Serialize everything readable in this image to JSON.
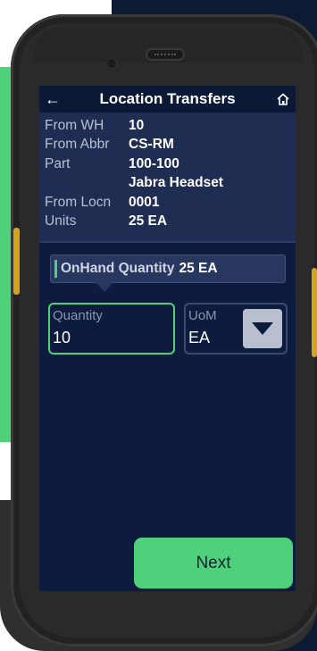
{
  "header": {
    "title": "Location Transfers",
    "back_icon": "←",
    "home_icon": "home-icon"
  },
  "details": [
    {
      "label": "From WH",
      "value": "10"
    },
    {
      "label": "From Abbr",
      "value": "CS-RM"
    },
    {
      "label": "Part",
      "value": "100-100"
    },
    {
      "label": "",
      "value": "Jabra Headset"
    },
    {
      "label": "From Locn",
      "value": "0001"
    },
    {
      "label": "Units",
      "value": "25 EA"
    }
  ],
  "onhand": {
    "label": "OnHand Quantity",
    "value": "25 EA"
  },
  "quantity": {
    "label": "Quantity",
    "value": "10"
  },
  "uom": {
    "label": "UoM",
    "value": "EA",
    "dropdown_icon": "chevron-down-icon"
  },
  "actions": {
    "next_label": "Next"
  },
  "colors": {
    "accent": "#4fd07b",
    "background": "#0d1b3f",
    "navy": "#0c1a33"
  }
}
